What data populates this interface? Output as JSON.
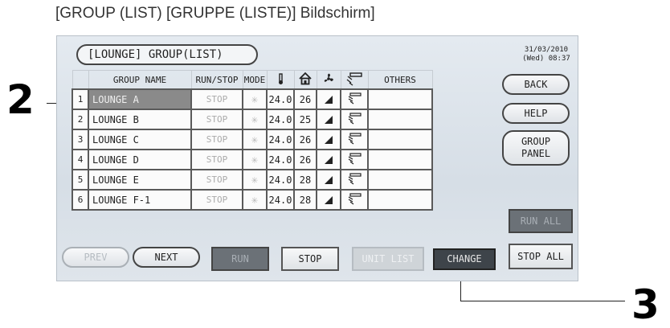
{
  "caption": "[GROUP (LIST) [GRUPPE (LISTE)] Bildschirm]",
  "screen_title": "[LOUNGE] GROUP(LIST)",
  "datetime": {
    "date": "31/03/2010",
    "time": "(Wed) 08:37"
  },
  "columns": {
    "group_name": "GROUP NAME",
    "run_stop": "RUN/STOP",
    "mode": "MODE",
    "set": "SET",
    "others": "OTHERS"
  },
  "rows": [
    {
      "num": "1",
      "name": "LOUNGE A",
      "status": "STOP",
      "set": "24.0",
      "room": "26"
    },
    {
      "num": "2",
      "name": "LOUNGE B",
      "status": "STOP",
      "set": "24.0",
      "room": "25"
    },
    {
      "num": "3",
      "name": "LOUNGE C",
      "status": "STOP",
      "set": "24.0",
      "room": "26"
    },
    {
      "num": "4",
      "name": "LOUNGE D",
      "status": "STOP",
      "set": "24.0",
      "room": "26"
    },
    {
      "num": "5",
      "name": "LOUNGE E",
      "status": "STOP",
      "set": "24.0",
      "room": "28"
    },
    {
      "num": "6",
      "name": "LOUNGE F-1",
      "status": "STOP",
      "set": "24.0",
      "room": "28"
    }
  ],
  "buttons": {
    "back": "BACK",
    "help": "HELP",
    "group_panel_line1": "GROUP",
    "group_panel_line2": "PANEL",
    "run_all": "RUN ALL",
    "stop_all": "STOP ALL",
    "prev": "PREV",
    "next": "NEXT",
    "run": "RUN",
    "stop": "STOP",
    "unit_list": "UNIT LIST",
    "change": "CHANGE"
  },
  "callouts": {
    "two": "2",
    "three": "3"
  },
  "icons": {
    "mode": "snowflake-icon",
    "set_temp": "thermometer-icon",
    "room_temp": "house-icon",
    "fan": "fan-icon",
    "louver": "louver-icon",
    "fan_speed": "fan-speed-icon"
  }
}
